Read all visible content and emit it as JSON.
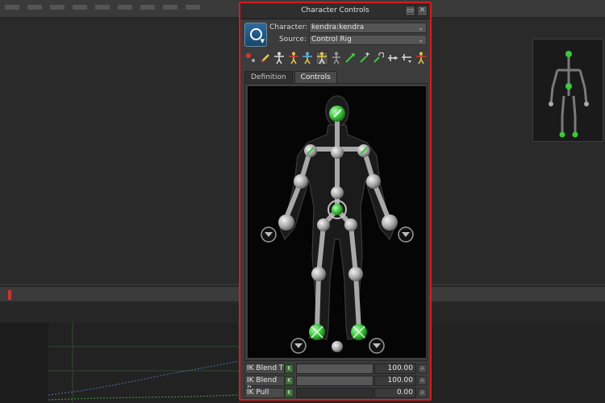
{
  "window": {
    "title": "Character Controls"
  },
  "character_row": {
    "label": "Character:",
    "value": "kendra:kendra"
  },
  "source_row": {
    "label": "Source:",
    "value": "Control Rig"
  },
  "toolbar": {
    "icons": [
      "select-effector-icon",
      "pencil-icon",
      "stance-icon",
      "full-body-icon",
      "body-part-icon",
      "selection-icon",
      "ik-icon",
      "fk-icon",
      "pin-translation-icon",
      "pin-rotation-icon",
      "release-pin-icon",
      "mirror-icon",
      "pose-icon"
    ]
  },
  "tabs": [
    {
      "label": "Definition",
      "active": false
    },
    {
      "label": "Controls",
      "active": true
    }
  ],
  "sliders": [
    {
      "label": "IK Blend T",
      "value": "100.00",
      "fraction": 1.0
    },
    {
      "label": "IK Blend R",
      "value": "100.00",
      "fraction": 1.0
    },
    {
      "label": "IK Pull",
      "value": "0.00",
      "fraction": 0.0
    }
  ],
  "colors": {
    "accent_border": "#d21e1e",
    "effector_green": "#3bc83b",
    "effector_gray": "#bdbdbd",
    "panel_bg": "#3c3c3c"
  }
}
